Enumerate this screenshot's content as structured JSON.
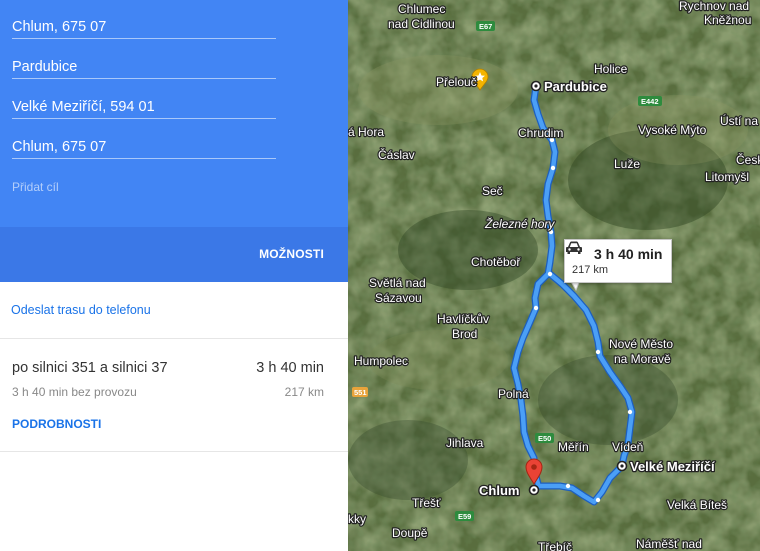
{
  "directions": {
    "waypoints": [
      {
        "label": "Chlum, 675 07"
      },
      {
        "label": "Pardubice"
      },
      {
        "label": "Velké Meziříčí, 594 01"
      },
      {
        "label": "Chlum, 675 07"
      }
    ],
    "add_destination": "Přidat cíl",
    "options_label": "MOŽNOSTI",
    "send_to_phone": "Odeslat trasu do telefonu",
    "route": {
      "via": "po silnici 351 a silnici 37",
      "duration": "3 h 40 min",
      "traffic_note": "3 h 40 min bez provozu",
      "distance": "217 km",
      "details_label": "PODROBNOSTI"
    }
  },
  "map": {
    "route_color": "#4b9ff6",
    "panel_color": "#4285f4",
    "bubble": {
      "duration": "3 h 40 min",
      "distance": "217 km",
      "icon": "car-icon"
    },
    "labels": {
      "chlumec": "Chlumec",
      "nad_cidlinou": "nad Cidlinou",
      "rychnov": "Rychnov nad",
      "kneznou": "Kněžnou",
      "prelouc": "Přelouč",
      "pardubice": "Pardubice",
      "holice": "Holice",
      "hora": "á Hora",
      "chrudim": "Chrudim",
      "vysoke_myto": "Vysoké Mýto",
      "usti": "Ústí na",
      "caslav": "Čáslav",
      "luze": "Luže",
      "cesk": "Česk",
      "litomysl": "Litomyšl",
      "sec": "Seč",
      "zelezne_hory": "Železné hory",
      "chotebor": "Chotěboř",
      "svetla": "Světlá nad",
      "sazavou": "Sázavou",
      "havlickuv": "Havlíčkův",
      "brod": "Brod",
      "nove_mesto": "Nové Město",
      "na_morave": "na Moravě",
      "humpolec": "Humpolec",
      "polna": "Polná",
      "jihlava": "Jihlava",
      "merin": "Měřín",
      "viden": "Vídeň",
      "velke_mezirici": "Velké Meziříčí",
      "chlum": "Chlum",
      "trest": "Třešť",
      "velka_bites": "Velká Bíteš",
      "kky": "kky",
      "doupe": "Doupě",
      "trebic": "Třebíč",
      "namest": "Náměšť nad",
      "road_e67": "E67",
      "road_e442": "E442",
      "road_e50": "E50",
      "road_e59": "E59",
      "road_551": "551"
    }
  }
}
